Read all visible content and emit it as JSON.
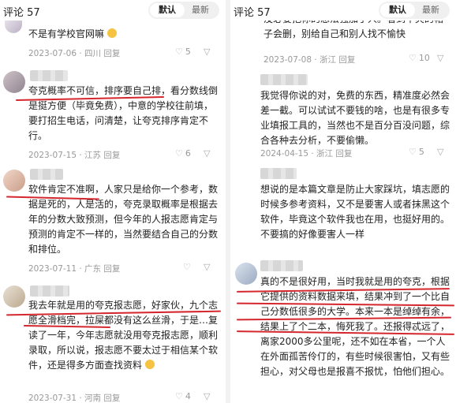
{
  "left": {
    "header": {
      "title": "评论 57",
      "tab_default": "默认",
      "tab_latest": "最新"
    },
    "comments": [
      {
        "text": "不是有学校官网嘛",
        "meta": "2023-07-06 · 四川 回复",
        "likes": "5"
      },
      {
        "text": "夸克概率不可信，排序要自己排，看分数线倒是挺方便（毕竟免费），中意的学校往前填，要打招生电话，问清楚，让夸克排序肯定不行。",
        "meta": "2023-07-15 · 江苏 回复",
        "likes": "6"
      },
      {
        "text": "软件肯定不准啊，人家只是给你一个参考，数据是死的，人是活的，夸克录取概率是根据去年的分数大致预测，但今年的人报志愿肯定与预测的肯定不一样的，当然要结合自己的分数和排位。",
        "meta": "2023-07-11 · 广东 回复",
        "likes": ""
      },
      {
        "text": "我去年就是用的夸克报志愿，好家伙，九个志愿全滑档完，拉屎都没有这么丝滑，于是…复读了一年，今年志愿就没用夸克报志愿，顺利录取，所以说，报志愿不要太过于相信某个软件，还是得多方面查找资料",
        "meta": "2023-07-31 · 河南 回复",
        "likes": "4"
      }
    ]
  },
  "right": {
    "header": {
      "title": "评论 57",
      "tab_default": "默认",
      "tab_latest": "最新"
    },
    "comments": [
      {
        "text": "没必要把你的想法强加于人。看到不爽的帖子会删，别给自己和别人找不愉快",
        "meta": "2023-07-08 · 浙江 回复",
        "likes": "10"
      },
      {
        "text": "我觉得你说的对，免费的东西，精准度必然会差一截。可以试试不要钱的啥，也是有很多专业填报工具的，当然也不是百分百没问题，综合各种去分析，不要偷懒。",
        "meta": "2024-04-15 · 浙江 回复",
        "likes": "5"
      },
      {
        "text": "想说的是本篇文章是防止大家踩坑，填志愿的时候多参考资料，又不是要害人或者抹黑这个软件，毕竟这个软件我也在用，也挺好用的。不要搞的好像要害人一样",
        "meta": "",
        "likes": ""
      },
      {
        "text": "真的不是很好用，当时我就是用的夸克，根据它提供的资料数据来填，结果冲到了一个比自己分数低很多的大学。本来一本是绰绰有余，结果上了个二本，悔死我了。还报得忒远了，离家2000多公里呢，还不如在本省，一个人在外面孤苦伶仃的，有些时候很害怕，又有些担心，对父母也是报喜不报忧，怕他们担心。",
        "meta": "",
        "likes": ""
      }
    ]
  }
}
